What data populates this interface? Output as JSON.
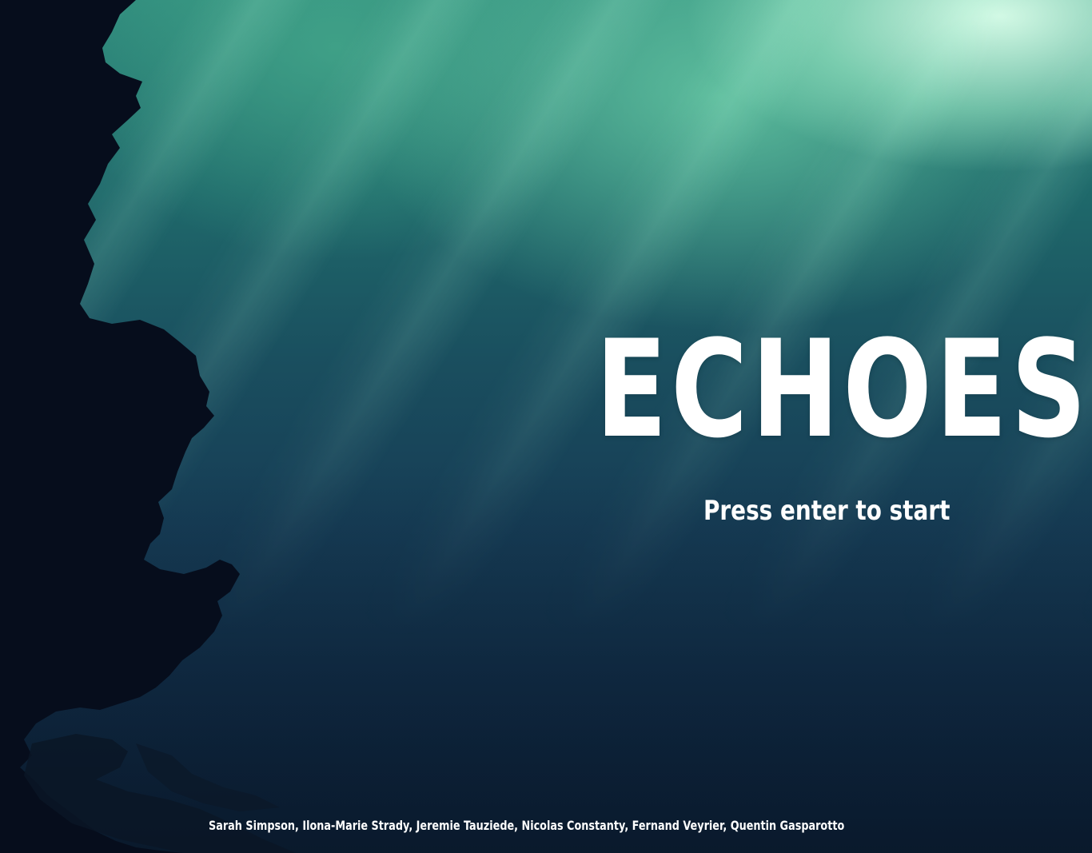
{
  "game": {
    "title": "ECHOES",
    "start_prompt": "Press enter to start",
    "credits": "Sarah Simpson, Ilona-Marie Strady, Jeremie Tauziede, Nicolas Constanty, Fernand Veyrier, Quentin Gasparotto"
  },
  "colors": {
    "water_light": "#bff5dc",
    "water_mid": "#1f6a6b",
    "water_deep": "#0d2238",
    "silhouette": "#060d1c",
    "text": "#ffffff"
  }
}
